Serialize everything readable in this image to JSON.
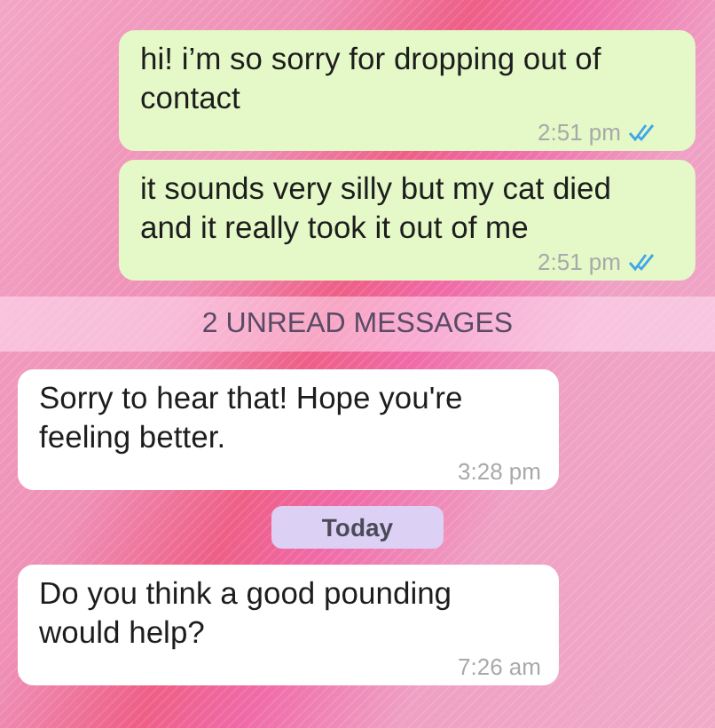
{
  "messages": [
    {
      "kind": "outgoing",
      "text": "hi! i’m so sorry for dropping out of contact",
      "time": "2:51 pm",
      "read": true
    },
    {
      "kind": "outgoing",
      "text": "it sounds very silly but my cat died and it really took it out of me",
      "time": "2:51 pm",
      "read": true
    },
    {
      "kind": "unread",
      "text": "2 UNREAD MESSAGES"
    },
    {
      "kind": "incoming",
      "text": "Sorry to hear that! Hope you're feeling better.",
      "time": "3:28 pm"
    },
    {
      "kind": "date",
      "text": "Today"
    },
    {
      "kind": "incoming",
      "text": "Do you think a good pounding would help?",
      "time": "7:26 am"
    }
  ]
}
